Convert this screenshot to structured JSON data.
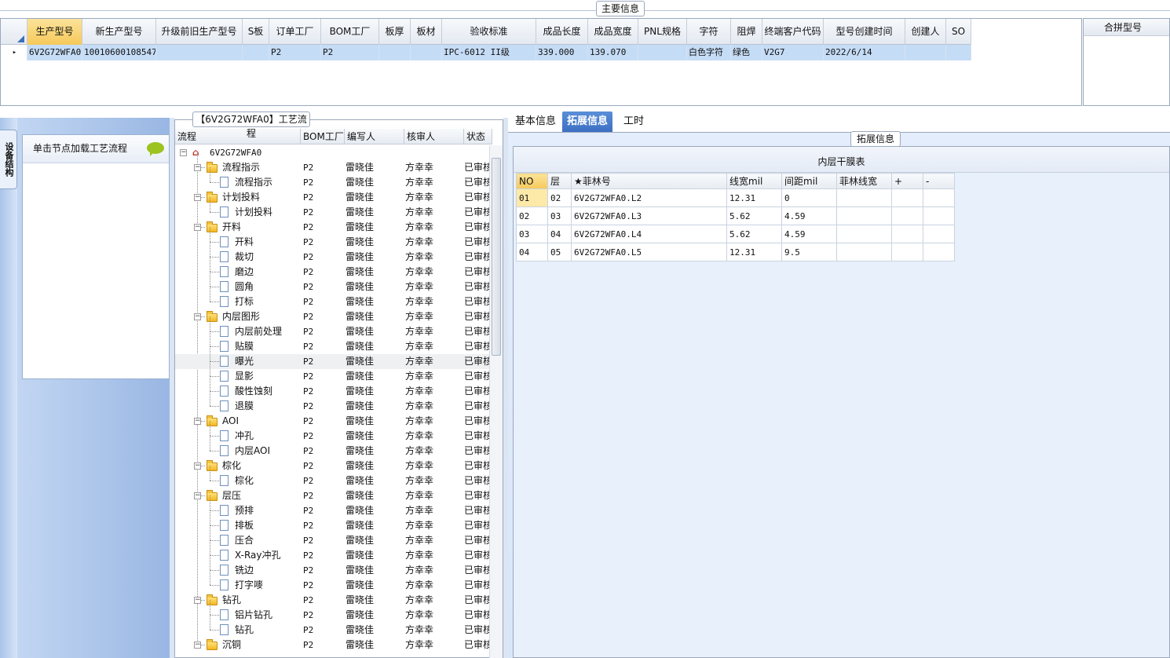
{
  "main_info": {
    "title": "主要信息",
    "columns": [
      "生产型号",
      "新生产型号",
      "升级前旧生产型号",
      "S板",
      "订单工厂",
      "BOM工厂",
      "板厚",
      "板材",
      "验收标准",
      "成品长度",
      "成品宽度",
      "PNL规格",
      "字符",
      "阻焊",
      "终端客户代码",
      "型号创建时间",
      "创建人",
      "SO"
    ],
    "row": [
      "6V2G72WFA0",
      "10010600108547",
      "",
      "",
      "P2",
      "P2",
      "",
      "",
      "IPC-6012 II级",
      "339.000",
      "139.070",
      "",
      "白色字符",
      "绿色",
      "V2G7",
      "2022/6/14",
      "",
      ""
    ],
    "row_marker": "▸"
  },
  "merge_panel": {
    "header": "合拼型号"
  },
  "side_tab": {
    "label": "设备结构"
  },
  "load_panel": {
    "label": "单击节点加载工艺流程"
  },
  "flow": {
    "title": "【6V2G72WFA0】工艺流程",
    "headers": [
      "流程",
      "BOM工厂",
      "编写人",
      "核审人",
      "状态"
    ],
    "root": "6V2G72WFA0",
    "rows": [
      {
        "name": "流程指示",
        "level": 1,
        "type": "folder",
        "bom": "P2",
        "writer": "雷晓佳",
        "reviewer": "方幸幸",
        "status": "已审核"
      },
      {
        "name": "流程指示",
        "level": 2,
        "type": "doc",
        "bom": "P2",
        "writer": "雷晓佳",
        "reviewer": "方幸幸",
        "status": "已审核"
      },
      {
        "name": "计划投料",
        "level": 1,
        "type": "folder",
        "bom": "P2",
        "writer": "雷晓佳",
        "reviewer": "方幸幸",
        "status": "已审核"
      },
      {
        "name": "计划投料",
        "level": 2,
        "type": "doc",
        "bom": "P2",
        "writer": "雷晓佳",
        "reviewer": "方幸幸",
        "status": "已审核"
      },
      {
        "name": "开料",
        "level": 1,
        "type": "folder",
        "bom": "P2",
        "writer": "雷晓佳",
        "reviewer": "方幸幸",
        "status": "已审核"
      },
      {
        "name": "开料",
        "level": 2,
        "type": "doc",
        "bom": "P2",
        "writer": "雷晓佳",
        "reviewer": "方幸幸",
        "status": "已审核"
      },
      {
        "name": "裁切",
        "level": 2,
        "type": "doc",
        "bom": "P2",
        "writer": "雷晓佳",
        "reviewer": "方幸幸",
        "status": "已审核"
      },
      {
        "name": "磨边",
        "level": 2,
        "type": "doc",
        "bom": "P2",
        "writer": "雷晓佳",
        "reviewer": "方幸幸",
        "status": "已审核"
      },
      {
        "name": "圆角",
        "level": 2,
        "type": "doc",
        "bom": "P2",
        "writer": "雷晓佳",
        "reviewer": "方幸幸",
        "status": "已审核"
      },
      {
        "name": "打标",
        "level": 2,
        "type": "doc",
        "bom": "P2",
        "writer": "雷晓佳",
        "reviewer": "方幸幸",
        "status": "已审核"
      },
      {
        "name": "内层图形",
        "level": 1,
        "type": "folder",
        "bom": "P2",
        "writer": "雷晓佳",
        "reviewer": "方幸幸",
        "status": "已审核"
      },
      {
        "name": "内层前处理",
        "level": 2,
        "type": "doc",
        "bom": "P2",
        "writer": "雷晓佳",
        "reviewer": "方幸幸",
        "status": "已审核"
      },
      {
        "name": "贴膜",
        "level": 2,
        "type": "doc",
        "bom": "P2",
        "writer": "雷晓佳",
        "reviewer": "方幸幸",
        "status": "已审核"
      },
      {
        "name": "曝光",
        "level": 2,
        "type": "doc",
        "bom": "P2",
        "writer": "雷晓佳",
        "reviewer": "方幸幸",
        "status": "已审核",
        "highlight": true
      },
      {
        "name": "显影",
        "level": 2,
        "type": "doc",
        "bom": "P2",
        "writer": "雷晓佳",
        "reviewer": "方幸幸",
        "status": "已审核"
      },
      {
        "name": "酸性蚀刻",
        "level": 2,
        "type": "doc",
        "bom": "P2",
        "writer": "雷晓佳",
        "reviewer": "方幸幸",
        "status": "已审核"
      },
      {
        "name": "退膜",
        "level": 2,
        "type": "doc",
        "bom": "P2",
        "writer": "雷晓佳",
        "reviewer": "方幸幸",
        "status": "已审核"
      },
      {
        "name": "AOI",
        "level": 1,
        "type": "folder",
        "bom": "P2",
        "writer": "雷晓佳",
        "reviewer": "方幸幸",
        "status": "已审核"
      },
      {
        "name": "冲孔",
        "level": 2,
        "type": "doc",
        "bom": "P2",
        "writer": "雷晓佳",
        "reviewer": "方幸幸",
        "status": "已审核"
      },
      {
        "name": "内层AOI",
        "level": 2,
        "type": "doc",
        "bom": "P2",
        "writer": "雷晓佳",
        "reviewer": "方幸幸",
        "status": "已审核"
      },
      {
        "name": "棕化",
        "level": 1,
        "type": "folder",
        "bom": "P2",
        "writer": "雷晓佳",
        "reviewer": "方幸幸",
        "status": "已审核"
      },
      {
        "name": "棕化",
        "level": 2,
        "type": "doc",
        "bom": "P2",
        "writer": "雷晓佳",
        "reviewer": "方幸幸",
        "status": "已审核"
      },
      {
        "name": "层压",
        "level": 1,
        "type": "folder",
        "bom": "P2",
        "writer": "雷晓佳",
        "reviewer": "方幸幸",
        "status": "已审核"
      },
      {
        "name": "预排",
        "level": 2,
        "type": "doc",
        "bom": "P2",
        "writer": "雷晓佳",
        "reviewer": "方幸幸",
        "status": "已审核"
      },
      {
        "name": "排板",
        "level": 2,
        "type": "doc",
        "bom": "P2",
        "writer": "雷晓佳",
        "reviewer": "方幸幸",
        "status": "已审核"
      },
      {
        "name": "压合",
        "level": 2,
        "type": "doc",
        "bom": "P2",
        "writer": "雷晓佳",
        "reviewer": "方幸幸",
        "status": "已审核"
      },
      {
        "name": "X-Ray冲孔",
        "level": 2,
        "type": "doc",
        "bom": "P2",
        "writer": "雷晓佳",
        "reviewer": "方幸幸",
        "status": "已审核"
      },
      {
        "name": "铣边",
        "level": 2,
        "type": "doc",
        "bom": "P2",
        "writer": "雷晓佳",
        "reviewer": "方幸幸",
        "status": "已审核"
      },
      {
        "name": "打字嘜",
        "level": 2,
        "type": "doc",
        "bom": "P2",
        "writer": "雷晓佳",
        "reviewer": "方幸幸",
        "status": "已审核"
      },
      {
        "name": "钻孔",
        "level": 1,
        "type": "folder",
        "bom": "P2",
        "writer": "雷晓佳",
        "reviewer": "方幸幸",
        "status": "已审核"
      },
      {
        "name": "铝片钻孔",
        "level": 2,
        "type": "doc",
        "bom": "P2",
        "writer": "雷晓佳",
        "reviewer": "方幸幸",
        "status": "已审核"
      },
      {
        "name": "钻孔",
        "level": 2,
        "type": "doc",
        "bom": "P2",
        "writer": "雷晓佳",
        "reviewer": "方幸幸",
        "status": "已审核"
      },
      {
        "name": "沉铜",
        "level": 1,
        "type": "folder",
        "bom": "P2",
        "writer": "雷晓佳",
        "reviewer": "方幸幸",
        "status": "已审核"
      }
    ]
  },
  "tabs": [
    {
      "label": "基本信息",
      "active": false
    },
    {
      "label": "拓展信息",
      "active": true
    },
    {
      "label": "工时",
      "active": false
    }
  ],
  "ext": {
    "title": "拓展信息",
    "table_caption": "内层干膜表",
    "headers": [
      "NO",
      "层",
      "★菲林号",
      "线宽mil",
      "间距mil",
      "菲林线宽",
      "+",
      "-"
    ],
    "rows": [
      [
        "01",
        "02",
        "6V2G72WFA0.L2",
        "12.31",
        "0",
        "",
        "",
        ""
      ],
      [
        "02",
        "03",
        "6V2G72WFA0.L3",
        "5.62",
        "4.59",
        "",
        "",
        ""
      ],
      [
        "03",
        "04",
        "6V2G72WFA0.L4",
        "5.62",
        "4.59",
        "",
        "",
        ""
      ],
      [
        "04",
        "05",
        "6V2G72WFA0.L5",
        "12.31",
        "9.5",
        "",
        "",
        ""
      ]
    ]
  },
  "colors": {
    "selected_row": "#c5dcf6",
    "active_tab": "#3c6fc2",
    "header_highlight": "#f6c95a"
  }
}
